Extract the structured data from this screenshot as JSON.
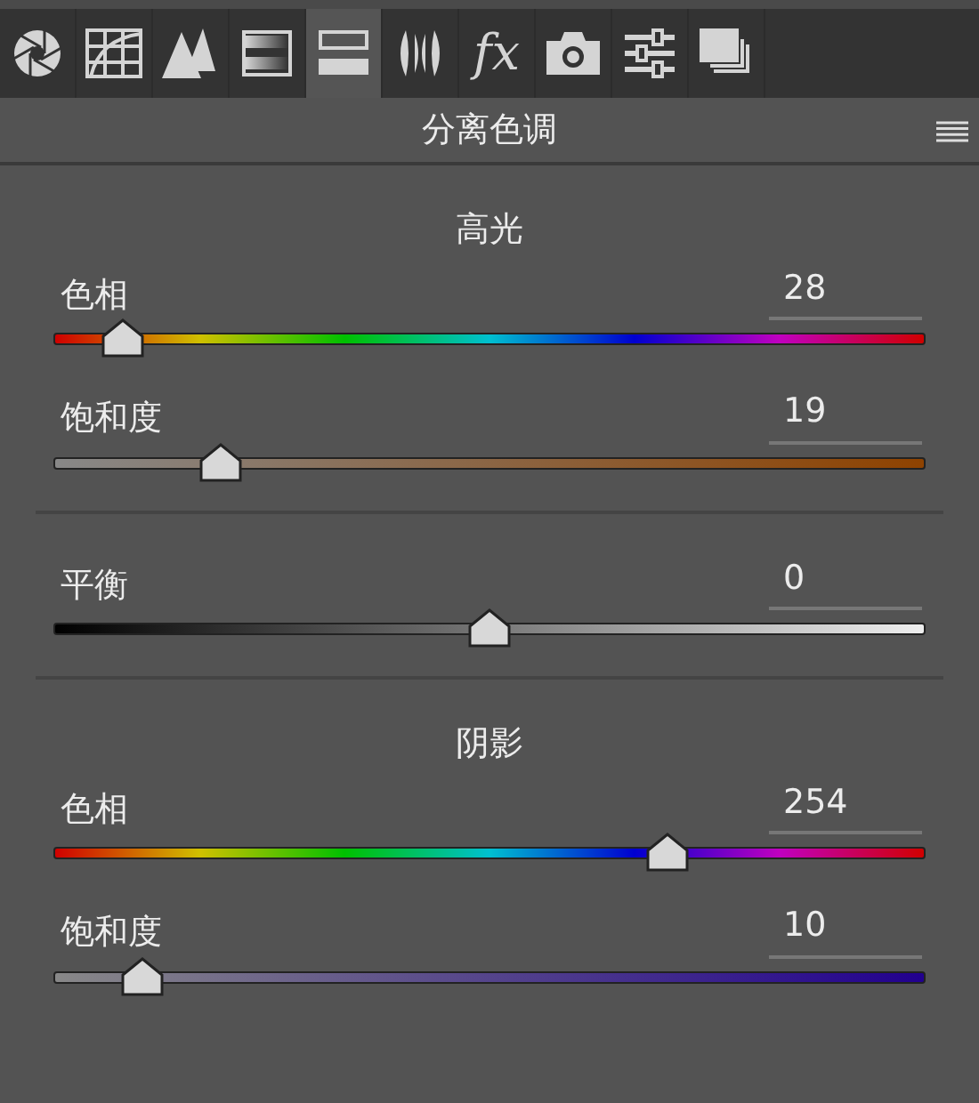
{
  "toolbar": [
    {
      "kind": "aperture",
      "selected": false
    },
    {
      "kind": "curve",
      "selected": false
    },
    {
      "kind": "peaks",
      "selected": false
    },
    {
      "kind": "gradient",
      "selected": false
    },
    {
      "kind": "split",
      "selected": true
    },
    {
      "kind": "lens",
      "selected": false
    },
    {
      "kind": "fx",
      "label": "fx",
      "selected": false
    },
    {
      "kind": "camera",
      "selected": false
    },
    {
      "kind": "sliders",
      "selected": false
    },
    {
      "kind": "stack",
      "selected": false
    }
  ],
  "panel": {
    "title": "分离色调"
  },
  "sections": [
    {
      "heading": "高光",
      "sliders": [
        {
          "kind": "hue",
          "label": "色相",
          "value": "28",
          "level": 0.078
        },
        {
          "kind": "saturation",
          "label": "饱和度",
          "value": "19",
          "level": 0.19
        }
      ]
    },
    {
      "sliders": [
        {
          "kind": "balance",
          "label": "平衡",
          "value": "0",
          "level": 0.5
        }
      ]
    },
    {
      "heading": "阴影",
      "sliders": [
        {
          "kind": "hue",
          "label": "色相",
          "value": "254",
          "level": 0.705
        },
        {
          "kind": "saturation",
          "label": "饱和度",
          "value": "10",
          "level": 0.1
        }
      ]
    }
  ]
}
